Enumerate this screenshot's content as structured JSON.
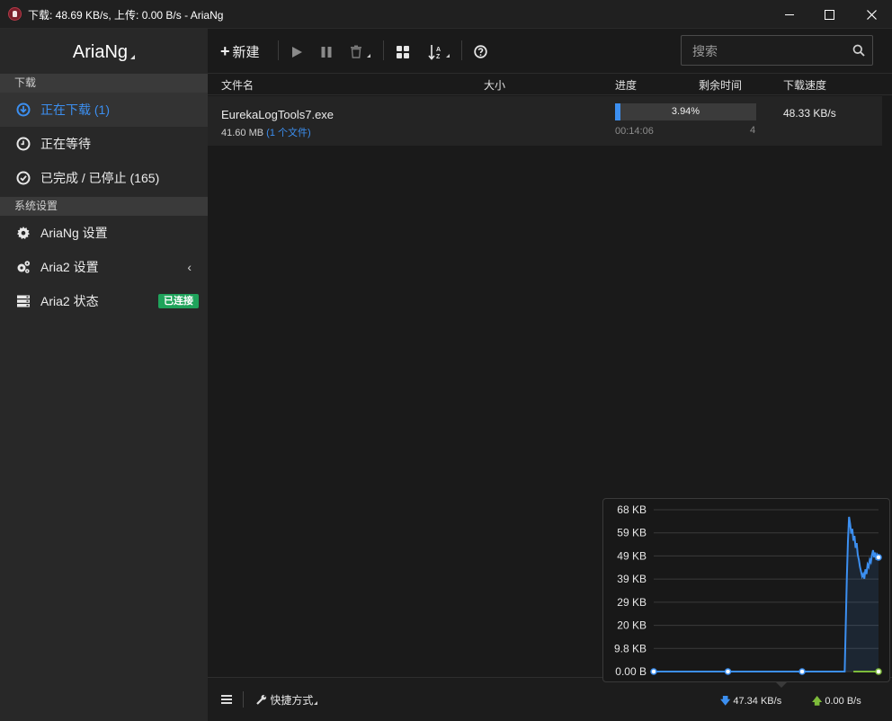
{
  "window": {
    "title": "下载: 48.69 KB/s, 上传: 0.00 B/s - AriaNg"
  },
  "sidebar": {
    "brand": "AriaNg",
    "download_header": "下载",
    "items": [
      {
        "label": "正在下载 (1)",
        "icon": "download-circle-icon",
        "active": true
      },
      {
        "label": "正在等待",
        "icon": "clock-icon"
      },
      {
        "label": "已完成 / 已停止 (165)",
        "icon": "check-circle-icon"
      }
    ],
    "settings_header": "系统设置",
    "settings": [
      {
        "label": "AriaNg 设置",
        "icon": "gear-icon"
      },
      {
        "label": "Aria2 设置",
        "icon": "gears-icon",
        "chevron": "‹"
      },
      {
        "label": "Aria2 状态",
        "icon": "server-icon",
        "badge": "已连接"
      }
    ]
  },
  "toolbar": {
    "new_label": "新建",
    "search_placeholder": "搜索"
  },
  "table": {
    "headers": {
      "name": "文件名",
      "size": "大小",
      "progress": "进度",
      "remaining": "剩余时间",
      "speed": "下载速度"
    },
    "rows": [
      {
        "name": "EurekaLogTools7.exe",
        "size": "41.60 MB",
        "files": "(1 个文件)",
        "progress": 3.94,
        "progress_text": "3.94%",
        "remaining": "00:14:06",
        "connections": "4",
        "speed": "48.33 KB/s"
      }
    ]
  },
  "footer": {
    "shortcut_label": "快捷方式",
    "download_speed": "47.34 KB/s",
    "upload_speed": "0.00 B/s"
  },
  "colors": {
    "accent": "#3c8ff0",
    "upload": "#7dbb3a",
    "badge": "#1fa35b"
  },
  "chart_data": {
    "type": "line",
    "ylabels": [
      "68 KB",
      "59 KB",
      "49 KB",
      "39 KB",
      "29 KB",
      "20 KB",
      "9.8 KB",
      "0.00 B"
    ],
    "ylim": [
      0,
      68
    ],
    "grid": true,
    "series": [
      {
        "name": "download",
        "color": "#3c8ff0",
        "values": [
          0,
          0,
          0,
          0,
          0,
          0,
          0,
          0,
          0,
          0,
          0,
          0,
          0,
          0,
          0,
          0,
          0,
          0,
          0,
          0,
          0,
          0,
          0,
          0,
          0,
          0,
          0,
          0,
          0,
          0,
          0,
          0,
          0,
          0,
          0,
          0,
          0,
          0,
          0,
          0,
          0,
          0,
          0,
          0,
          0,
          0,
          0,
          0,
          0,
          0,
          0,
          0,
          0,
          0,
          0,
          0,
          0,
          0,
          0,
          0,
          0,
          0,
          0,
          0,
          0,
          0,
          0,
          0,
          0,
          0,
          0,
          0,
          0,
          0,
          0,
          0,
          0,
          0,
          0,
          0,
          0,
          0,
          0,
          0,
          0,
          0,
          0,
          0,
          0,
          0,
          0,
          0,
          0,
          0,
          0,
          0,
          0,
          0,
          0,
          0,
          0,
          0,
          0,
          0,
          0,
          0,
          0,
          0,
          0,
          0,
          0,
          0,
          0,
          0,
          0,
          0,
          0,
          0,
          0,
          0,
          0,
          0,
          0,
          0,
          0,
          0,
          0,
          0,
          0,
          0,
          0,
          0,
          0,
          0,
          0,
          0,
          0,
          0,
          0,
          0,
          0,
          0,
          0,
          0,
          0,
          0,
          0,
          0,
          0,
          0,
          0,
          0,
          0,
          0,
          0,
          0,
          0,
          0,
          0,
          0,
          0,
          0,
          0,
          0,
          0,
          0,
          0,
          0,
          0,
          0,
          0,
          0,
          0,
          0,
          0,
          0,
          20,
          40,
          55,
          65,
          62,
          58,
          60,
          55,
          57,
          52,
          54,
          49,
          47,
          44,
          42,
          40,
          41,
          39,
          43,
          41,
          45,
          44,
          47,
          46,
          49,
          51,
          48,
          50,
          47,
          49,
          48
        ]
      },
      {
        "name": "upload",
        "color": "#7dbb3a",
        "values": [
          0,
          0,
          0,
          0,
          0
        ]
      }
    ]
  }
}
